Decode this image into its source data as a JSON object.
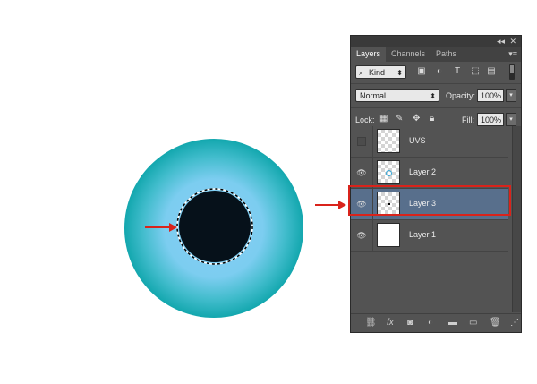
{
  "panel": {
    "tabs": [
      {
        "label": "Layers",
        "active": true
      },
      {
        "label": "Channels",
        "active": false
      },
      {
        "label": "Paths",
        "active": false
      }
    ],
    "filter": {
      "kind_label": "Kind"
    },
    "blend_mode": "Normal",
    "opacity_label": "Opacity:",
    "opacity_value": "100%",
    "lock_label": "Lock:",
    "fill_label": "Fill:",
    "fill_value": "100%",
    "layers": [
      {
        "name": "UVS",
        "visible": false,
        "selected": false,
        "thumbnail": "transparent"
      },
      {
        "name": "Layer 2",
        "visible": true,
        "selected": false,
        "thumbnail": "ring"
      },
      {
        "name": "Layer 3",
        "visible": true,
        "selected": true,
        "thumbnail": "transparent"
      },
      {
        "name": "Layer 1",
        "visible": true,
        "selected": false,
        "thumbnail": "white"
      }
    ]
  },
  "colors": {
    "panel_bg": "#535353",
    "selected_layer": "#586f8c",
    "annotation_red": "#d9231b",
    "eye_outer": "#13a7ae",
    "eye_inner": "#86cef6",
    "pupil": "#06111a"
  }
}
